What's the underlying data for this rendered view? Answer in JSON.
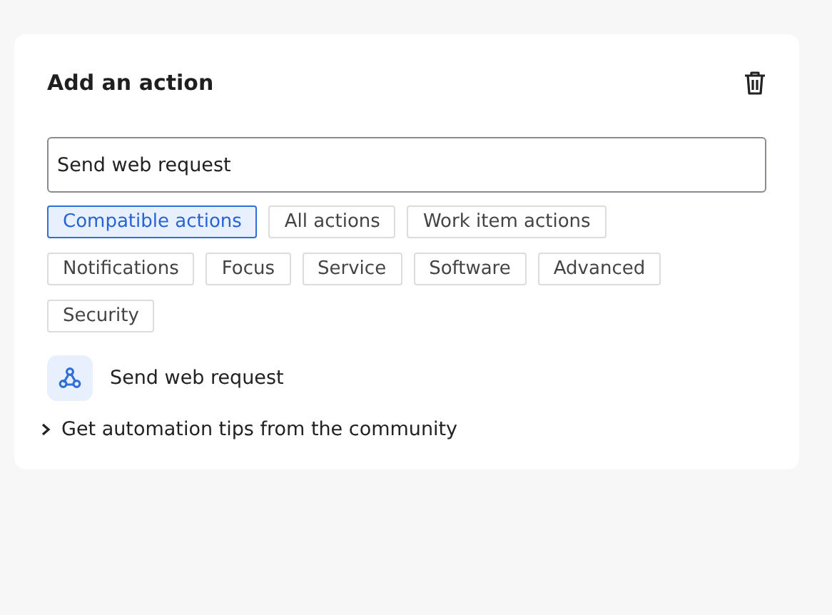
{
  "panel": {
    "title": "Add an action"
  },
  "search": {
    "value": "Send web request"
  },
  "filters": [
    {
      "label": "Compatible actions",
      "selected": true
    },
    {
      "label": "All actions",
      "selected": false
    },
    {
      "label": "Work item actions",
      "selected": false
    },
    {
      "label": "Notifications",
      "selected": false
    },
    {
      "label": "Focus",
      "selected": false
    },
    {
      "label": "Service",
      "selected": false
    },
    {
      "label": "Software",
      "selected": false
    },
    {
      "label": "Advanced",
      "selected": false
    },
    {
      "label": "Security",
      "selected": false
    }
  ],
  "results": [
    {
      "label": "Send web request"
    }
  ],
  "tips": {
    "label": "Get automation tips from the community",
    "expanded": false
  }
}
